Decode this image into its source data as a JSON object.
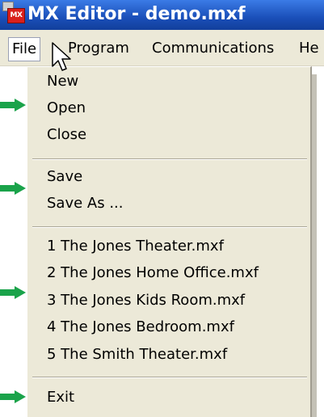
{
  "window": {
    "title": "MX Editor - demo.mxf",
    "icon_label": "MX"
  },
  "menubar": {
    "items": [
      {
        "label": "File"
      },
      {
        "label": "Program"
      },
      {
        "label": "Communications"
      },
      {
        "label": "He"
      }
    ]
  },
  "file_menu": {
    "items": [
      {
        "label": "New"
      },
      {
        "label": "Open"
      },
      {
        "label": "Close"
      },
      {
        "label": "Save"
      },
      {
        "label": "Save As ..."
      },
      {
        "label": "1 The Jones Theater.mxf"
      },
      {
        "label": "2 The Jones Home Office.mxf"
      },
      {
        "label": "3 The Jones Kids Room.mxf"
      },
      {
        "label": "4 The Jones Bedroom.mxf"
      },
      {
        "label": "5 The Smith Theater.mxf"
      },
      {
        "label": "Exit"
      }
    ]
  },
  "colors": {
    "title_bar": "#1f5bc4",
    "menu_background": "#ece9d8",
    "arrow": "#1aa34a"
  }
}
